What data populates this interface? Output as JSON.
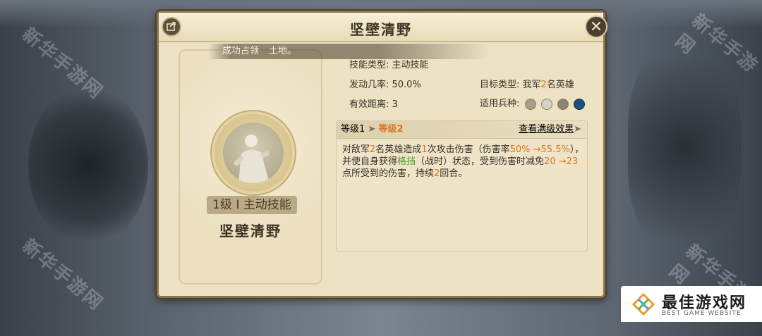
{
  "panel": {
    "title": "坚壁清野",
    "close_icon": "close-icon",
    "share_icon": "share-icon"
  },
  "toast": {
    "prefix": "",
    "mid": "成功占领",
    "suffix": "土地。"
  },
  "skill_card": {
    "level_tag": "1级 I 主动技能",
    "name": "坚壁清野"
  },
  "info": {
    "skill_type": "技能类型: 主动技能",
    "trigger_rate": "发动几率: 50.0%",
    "range": "有效距离: 3",
    "target_label": "目标类型: 我军",
    "target_count": "2",
    "target_suffix": "名英雄",
    "troop_label": "适用兵种:"
  },
  "level_bar": {
    "level1": "等级1",
    "arrow": "➤",
    "level2": "等级2",
    "view_max": "查看满级效果",
    "view_arrow": "➤"
  },
  "description": {
    "p1": "对敌军",
    "n1": "2",
    "p2": "名英雄造成",
    "n2": "1",
    "p3": "次攻击伤害（伤害率",
    "r1": "50% →55.5%",
    "p4": "），并使自身获得",
    "status": "格挡",
    "p5": "（战时）状态，受到伤害时减免",
    "r2": "20 →23",
    "p6": "点所受到的伤害，持续",
    "n3": "2",
    "p7": "回合。"
  },
  "logo": {
    "text": "最佳游戏网",
    "sub": "BEST GAME WEBSITE"
  },
  "watermarks": [
    "新华手游网",
    "新华手游网",
    "新华手游网",
    "新华手游网"
  ],
  "colors": {
    "accent_orange": "#d9761f",
    "status_green": "#4f9a2c",
    "panel_bg": "#ede2c4"
  }
}
